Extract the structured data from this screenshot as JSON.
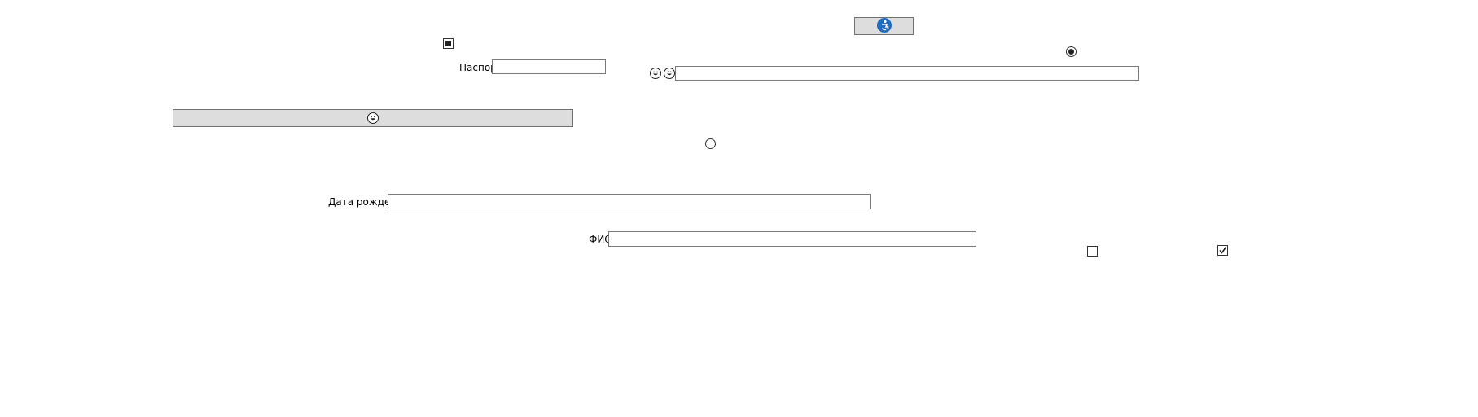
{
  "form": {
    "passport_label": "Паспорт",
    "passport_value": "",
    "birthdate_label": "Дата рождения",
    "birthdate_value": "",
    "fio_label": "ФИО",
    "fio_value": "",
    "emoji_field_value": ""
  },
  "buttons": {
    "top_button_icon": "accessibility-icon",
    "wide_button_icon": "grinning-face-icon"
  },
  "controls": {
    "checkbox_top_state": "indeterminate",
    "radio_top_right_selected": true,
    "radio_middle_selected": false,
    "checkbox_bottom_left_checked": false,
    "checkbox_bottom_right_checked": true
  },
  "icons": {
    "emoji_1": "laughing-face-icon",
    "emoji_2": "smiling-face-icon"
  },
  "colors": {
    "accent_icon_blue": "#1e6bbf",
    "button_bg": "#dddddd",
    "field_border": "#7a7a7a"
  }
}
